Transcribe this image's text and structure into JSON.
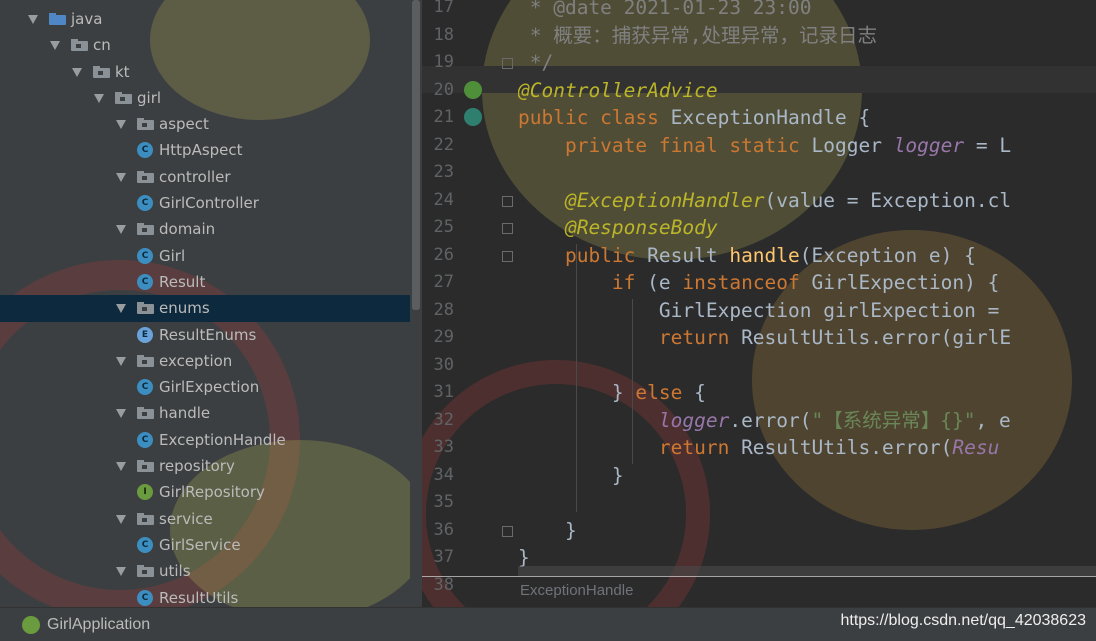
{
  "tree": {
    "items": [
      {
        "label": "java",
        "kind": "folder-java",
        "level": 0
      },
      {
        "label": "cn",
        "kind": "package",
        "level": 1
      },
      {
        "label": "kt",
        "kind": "package",
        "level": 2
      },
      {
        "label": "girl",
        "kind": "package",
        "level": 3
      },
      {
        "label": "aspect",
        "kind": "package",
        "level": 4
      },
      {
        "label": "HttpAspect",
        "kind": "class",
        "level": 5
      },
      {
        "label": "controller",
        "kind": "package",
        "level": 4
      },
      {
        "label": "GirlController",
        "kind": "class",
        "level": 5
      },
      {
        "label": "domain",
        "kind": "package",
        "level": 4
      },
      {
        "label": "Girl",
        "kind": "class",
        "level": 5
      },
      {
        "label": "Result",
        "kind": "class",
        "level": 5
      },
      {
        "label": "enums",
        "kind": "package",
        "level": 4,
        "selected": true
      },
      {
        "label": "ResultEnums",
        "kind": "enum",
        "level": 5
      },
      {
        "label": "exception",
        "kind": "package",
        "level": 4
      },
      {
        "label": "GirlExpection",
        "kind": "class",
        "level": 5
      },
      {
        "label": "handle",
        "kind": "package",
        "level": 4
      },
      {
        "label": "ExceptionHandle",
        "kind": "class",
        "level": 5
      },
      {
        "label": "repository",
        "kind": "package",
        "level": 4
      },
      {
        "label": "GirlRepository",
        "kind": "interface",
        "level": 5
      },
      {
        "label": "service",
        "kind": "package",
        "level": 4
      },
      {
        "label": "GirlService",
        "kind": "class",
        "level": 5
      },
      {
        "label": "utils",
        "kind": "package",
        "level": 4
      },
      {
        "label": "ResultUtils",
        "kind": "class",
        "level": 5
      }
    ]
  },
  "editor": {
    "line_numbers": [
      "17",
      "18",
      "19",
      "20",
      "21",
      "22",
      "23",
      "24",
      "25",
      "26",
      "27",
      "28",
      "29",
      "30",
      "31",
      "32",
      "33",
      "34",
      "35",
      "36",
      "37",
      "38"
    ],
    "lines": [
      [
        {
          "t": " * @date 2021-01-23 23:00",
          "c": "cmt"
        }
      ],
      [
        {
          "t": " * 概要：捕获异常,处理异常，记录日志",
          "c": "cmt"
        }
      ],
      [
        {
          "t": " */",
          "c": "cmt"
        }
      ],
      [
        {
          "t": "@ControllerAdvice",
          "c": "ann ital"
        }
      ],
      [
        {
          "t": "public class ",
          "c": "kw"
        },
        {
          "t": "ExceptionHandle ",
          "c": ""
        },
        {
          "t": "{",
          "c": ""
        }
      ],
      [
        {
          "t": "    private final static ",
          "c": "kw"
        },
        {
          "t": "Logger ",
          "c": ""
        },
        {
          "t": "logger",
          "c": "purple ital"
        },
        {
          "t": " = L",
          "c": ""
        }
      ],
      [
        {
          "t": "",
          "c": ""
        }
      ],
      [
        {
          "t": "    @ExceptionHandler",
          "c": "ann ital"
        },
        {
          "t": "(value = Exception.cl",
          "c": ""
        }
      ],
      [
        {
          "t": "    @ResponseBody",
          "c": "ann ital"
        }
      ],
      [
        {
          "t": "    public ",
          "c": "kw"
        },
        {
          "t": "Result ",
          "c": ""
        },
        {
          "t": "handle",
          "c": "cls"
        },
        {
          "t": "(Exception e) {",
          "c": ""
        }
      ],
      [
        {
          "t": "        if ",
          "c": "kw"
        },
        {
          "t": "(e ",
          "c": ""
        },
        {
          "t": "instanceof ",
          "c": "kw"
        },
        {
          "t": "GirlExpection) {",
          "c": ""
        }
      ],
      [
        {
          "t": "            GirlExpection girlExpection = ",
          "c": ""
        }
      ],
      [
        {
          "t": "            return ",
          "c": "kw"
        },
        {
          "t": "ResultUtils.error(girlE",
          "c": ""
        }
      ],
      [
        {
          "t": "",
          "c": ""
        }
      ],
      [
        {
          "t": "        } ",
          "c": ""
        },
        {
          "t": "else ",
          "c": "kw"
        },
        {
          "t": "{",
          "c": ""
        }
      ],
      [
        {
          "t": "            ",
          "c": ""
        },
        {
          "t": "logger",
          "c": "purple ital"
        },
        {
          "t": ".error(",
          "c": ""
        },
        {
          "t": "\"【系统异常】{}\"",
          "c": "str"
        },
        {
          "t": ", e",
          "c": ""
        }
      ],
      [
        {
          "t": "            return ",
          "c": "kw"
        },
        {
          "t": "ResultUtils.error(",
          "c": ""
        },
        {
          "t": "Resu",
          "c": "purple ital"
        }
      ],
      [
        {
          "t": "        }",
          "c": ""
        }
      ],
      [
        {
          "t": "",
          "c": ""
        }
      ],
      [
        {
          "t": "    }",
          "c": ""
        }
      ],
      [
        {
          "t": "}",
          "c": ""
        }
      ],
      [
        {
          "t": "",
          "c": ""
        }
      ]
    ]
  },
  "breadcrumb": "ExceptionHandle",
  "run_config": "GirlApplication",
  "watermark": "https://blog.csdn.net/qq_42038623",
  "colors": {
    "keyword": "#cc7832",
    "annotation": "#bbb529",
    "method": "#ffc66d",
    "field": "#9876aa",
    "comment": "#808080",
    "string": "#6a8759",
    "selection": "#0d293e"
  }
}
